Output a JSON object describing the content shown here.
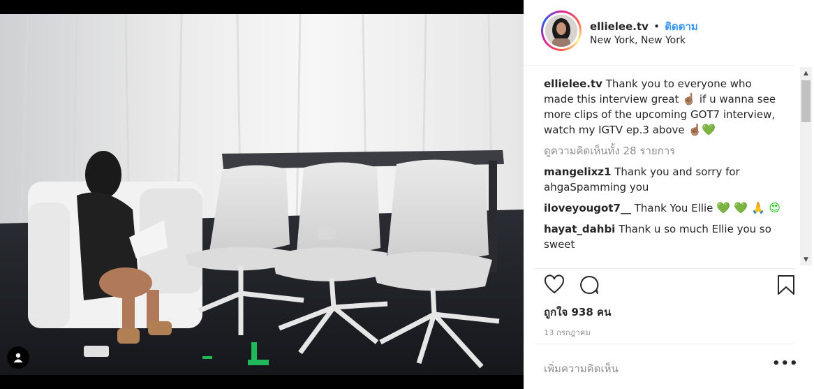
{
  "post": {
    "username": "ellielee.tv",
    "separator": "•",
    "follow_label": "ติดตาม",
    "location": "New York, New York"
  },
  "caption": {
    "username": "ellielee.tv",
    "text_1": "Thank you to everyone who made this interview great",
    "emoji_1": "☝🏽",
    "text_2": "if u wanna see more clips of the upcoming GOT7 interview, watch my IGTV ep.3 above",
    "emoji_2": "☝🏽",
    "emoji_3": "💚"
  },
  "view_all_comments": "ดูความคิดเห็นทั้ง 28 รายการ",
  "comments": [
    {
      "username": "mangelixz1",
      "text": "Thank you and sorry for ahgaSpamming you",
      "emoji": ""
    },
    {
      "username": "iloveyougot7__",
      "text": "Thank You Ellie",
      "emoji": "💚 💚 🙏 😍"
    },
    {
      "username": "hayat_dahbi",
      "text": "Thank u so much Ellie you so sweet",
      "emoji": ""
    }
  ],
  "likes_text": "ถูกใจ 938 คน",
  "date_text": "13 กรกฎาคม",
  "add_comment_placeholder": "เพิ่มความคิดเห็น",
  "more_label": "•••",
  "icons": {
    "like": "heart-outline-icon",
    "comment": "speech-bubble-icon",
    "save": "bookmark-icon",
    "tag": "user-tag-icon"
  },
  "colors": {
    "link_blue": "#3897f0",
    "muted_gray": "#8e8e8e",
    "text_dark": "#262626"
  }
}
